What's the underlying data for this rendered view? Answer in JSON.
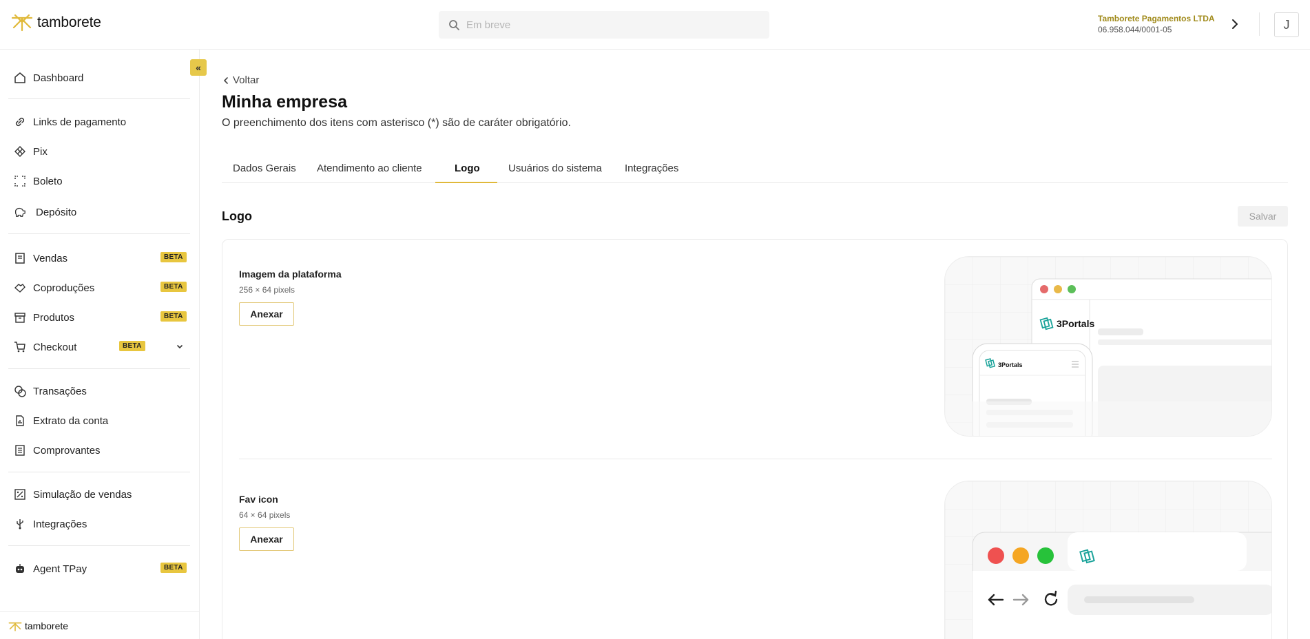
{
  "header": {
    "brand": "tamborete",
    "search_placeholder": "Em breve",
    "company_name": "Tamborete Pagamentos LTDA",
    "company_doc": "06.958.044/0001-05",
    "avatar_initial": "J",
    "accent_color": "#e8c63f"
  },
  "sidebar": {
    "collapse_label": "«",
    "items": [
      {
        "label": "Dashboard",
        "icon": "home-icon"
      },
      {
        "label": "Links de pagamento",
        "icon": "link-icon"
      },
      {
        "label": "Pix",
        "icon": "pix-icon"
      },
      {
        "label": "Boleto",
        "icon": "scan-icon"
      },
      {
        "label": "Depósito",
        "icon": "piggy-bank-icon"
      },
      {
        "label": "Vendas",
        "icon": "receipt-icon",
        "badge": "BETA"
      },
      {
        "label": "Coproduções",
        "icon": "handshake-icon",
        "badge": "BETA"
      },
      {
        "label": "Produtos",
        "icon": "archive-icon",
        "badge": "BETA"
      },
      {
        "label": "Checkout",
        "icon": "cart-icon",
        "badge": "BETA"
      },
      {
        "label": "Transações",
        "icon": "coins-icon"
      },
      {
        "label": "Extrato da conta",
        "icon": "statement-icon"
      },
      {
        "label": "Comprovantes",
        "icon": "list-icon"
      },
      {
        "label": "Simulação de vendas",
        "icon": "percent-icon"
      },
      {
        "label": "Integrações",
        "icon": "usb-icon"
      },
      {
        "label": "Agent TPay",
        "icon": "bot-icon",
        "badge": "BETA"
      }
    ],
    "footer_brand": "tamborete"
  },
  "main": {
    "back_label": "Voltar",
    "title": "Minha empresa",
    "subtitle": "O preenchimento dos itens com asterisco (*) são de caráter obrigatório.",
    "tabs": [
      "Dados Gerais",
      "Atendimento ao cliente",
      "Logo",
      "Usuários do sistema",
      "Integrações"
    ],
    "active_tab": "Logo",
    "section_title": "Logo",
    "save_label": "Salvar",
    "fields": [
      {
        "label": "Imagem da plataforma",
        "size": "256 × 64 pixels",
        "button": "Anexar"
      },
      {
        "label": "Fav icon",
        "size": "64 × 64 pixels",
        "button": "Anexar"
      }
    ],
    "preview_brand": "3Portals"
  }
}
